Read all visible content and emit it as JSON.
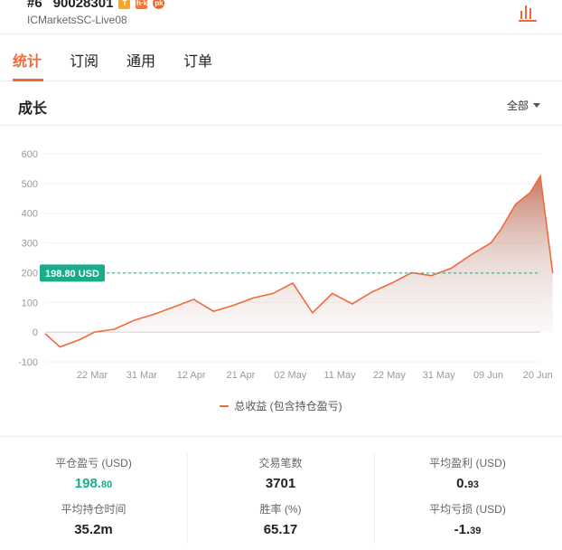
{
  "header": {
    "rank": "#6",
    "account_number": "90028301",
    "badges": [
      {
        "text": "T",
        "color": "#f5a623"
      },
      {
        "text": "h·k",
        "color": "#f07a3c"
      },
      {
        "text": "pk",
        "color": "#e56a2a"
      }
    ],
    "server": "ICMarketsSC-Live08",
    "chart_icon": "bar-chart-icon"
  },
  "tabs": [
    {
      "label": "统计",
      "active": true
    },
    {
      "label": "订阅",
      "active": false
    },
    {
      "label": "通用",
      "active": false
    },
    {
      "label": "订单",
      "active": false
    }
  ],
  "section": {
    "title": "成长",
    "range_label": "全部"
  },
  "colors": {
    "accent": "#ef6a3a",
    "teal": "#1aab8a"
  },
  "chart_data": {
    "type": "area",
    "title": "",
    "xlabel": "",
    "ylabel": "",
    "ylim": [
      -100,
      600
    ],
    "yticks": [
      "600",
      "500",
      "400",
      "300",
      "200",
      "100",
      "0",
      "-100"
    ],
    "xticks": [
      "22 Mar",
      "31 Mar",
      "12 Apr",
      "21 Apr",
      "02 May",
      "11 May",
      "22 May",
      "31 May",
      "09 Jun",
      "20 Jun"
    ],
    "grid": true,
    "legend_position": "bottom-center",
    "current_value_label": "198.80 USD",
    "current_value": 198.8,
    "series": [
      {
        "name": "总收益 (包含持仓盈亏)",
        "color": "#ef6a3a",
        "x": [
          0,
          0.3,
          0.7,
          1,
          1.4,
          1.8,
          2.2,
          2.6,
          3,
          3.4,
          3.8,
          4.2,
          4.6,
          5,
          5.4,
          5.8,
          6.2,
          6.6,
          7,
          7.4,
          7.8,
          8.2,
          8.6,
          9,
          9.2,
          9.5,
          9.8,
          10,
          10.25
        ],
        "y": [
          -5,
          -50,
          -25,
          0,
          10,
          40,
          60,
          85,
          110,
          70,
          90,
          115,
          130,
          165,
          65,
          130,
          95,
          135,
          165,
          200,
          190,
          215,
          260,
          300,
          345,
          430,
          470,
          525,
          198.8
        ]
      }
    ]
  },
  "stats": [
    {
      "label": "平仓盈亏 (USD)",
      "value_int": "198.",
      "value_dec": "80",
      "tone": "green"
    },
    {
      "label": "交易笔数",
      "value_int": "3701",
      "value_dec": "",
      "tone": "default"
    },
    {
      "label": "平均盈利 (USD)",
      "value_int": "0.",
      "value_dec": "93",
      "tone": "default"
    },
    {
      "label": "平均持仓时间",
      "value_int": "35.2m",
      "value_dec": "",
      "tone": "default"
    },
    {
      "label": "胜率 (%)",
      "value_int": "65.17",
      "value_dec": "",
      "tone": "default"
    },
    {
      "label": "平均亏损 (USD)",
      "value_int": "-1.",
      "value_dec": "39",
      "tone": "default"
    }
  ]
}
